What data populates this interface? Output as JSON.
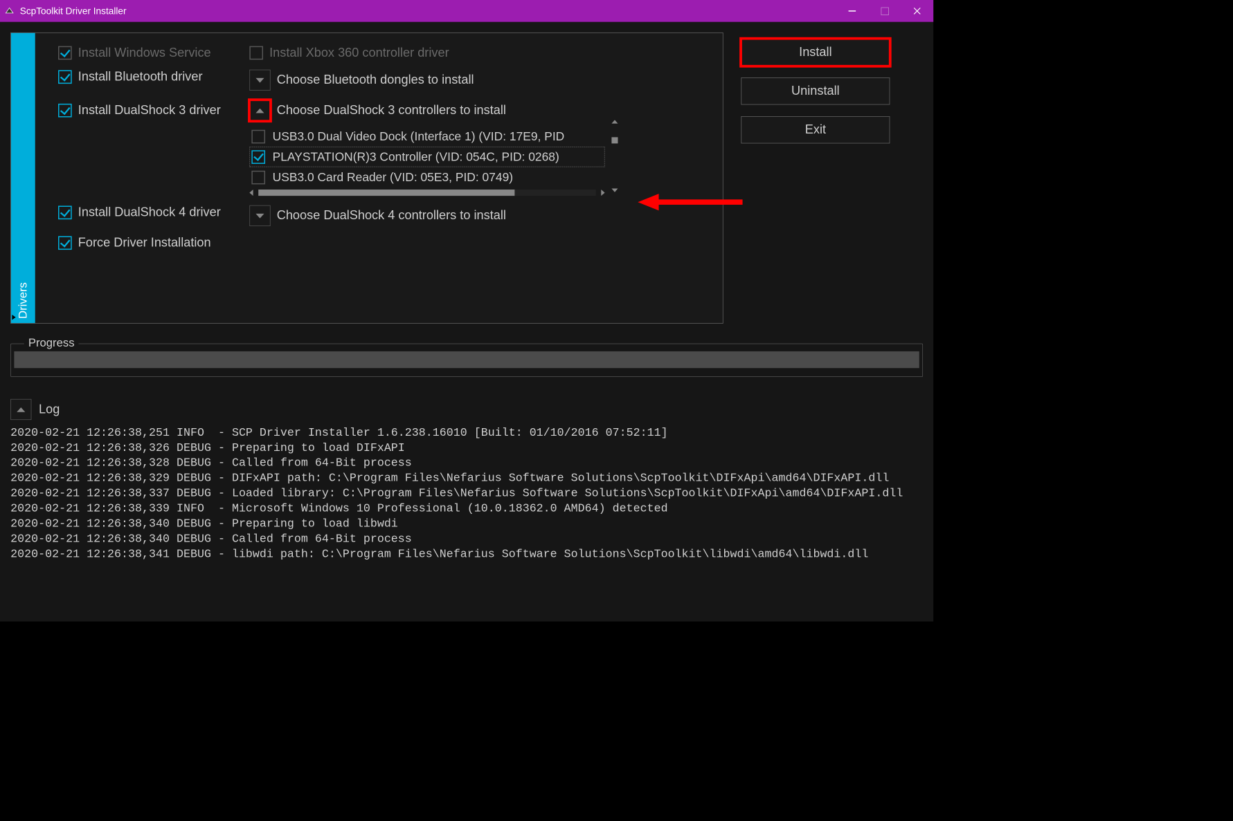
{
  "window": {
    "title": "ScpToolkit Driver Installer"
  },
  "drivers": {
    "tab_label": "Drivers",
    "install_windows_service": {
      "label": "Install Windows Service",
      "checked": true,
      "disabled": true
    },
    "install_xbox360": {
      "label": "Install Xbox 360 controller driver",
      "checked": false,
      "disabled": true
    },
    "install_bluetooth": {
      "label": "Install Bluetooth driver",
      "checked": true
    },
    "bluetooth_dropdown": {
      "label": "Choose Bluetooth dongles to install",
      "expanded": false
    },
    "install_ds3": {
      "label": "Install DualShock 3 driver",
      "checked": true
    },
    "ds3_dropdown": {
      "label": "Choose DualShock 3 controllers to install",
      "expanded": true
    },
    "ds3_devices": [
      {
        "label": "USB3.0 Dual Video Dock (Interface 1) (VID: 17E9, PID",
        "checked": false
      },
      {
        "label": "PLAYSTATION(R)3 Controller (VID: 054C, PID: 0268)",
        "checked": true,
        "selected": true
      },
      {
        "label": "USB3.0 Card Reader (VID: 05E3, PID: 0749)",
        "checked": false
      }
    ],
    "install_ds4": {
      "label": "Install DualShock 4 driver",
      "checked": true
    },
    "ds4_dropdown": {
      "label": "Choose DualShock 4 controllers to install",
      "expanded": false
    },
    "force_install": {
      "label": "Force Driver Installation",
      "checked": true
    }
  },
  "actions": {
    "install": "Install",
    "uninstall": "Uninstall",
    "exit": "Exit"
  },
  "progress": {
    "label": "Progress"
  },
  "log": {
    "label": "Log",
    "lines": [
      "2020-02-21 12:26:38,251 INFO  - SCP Driver Installer 1.6.238.16010 [Built: 01/10/2016 07:52:11]",
      "2020-02-21 12:26:38,326 DEBUG - Preparing to load DIFxAPI",
      "2020-02-21 12:26:38,328 DEBUG - Called from 64-Bit process",
      "2020-02-21 12:26:38,329 DEBUG - DIFxAPI path: C:\\Program Files\\Nefarius Software Solutions\\ScpToolkit\\DIFxApi\\amd64\\DIFxAPI.dll",
      "2020-02-21 12:26:38,337 DEBUG - Loaded library: C:\\Program Files\\Nefarius Software Solutions\\ScpToolkit\\DIFxApi\\amd64\\DIFxAPI.dll",
      "2020-02-21 12:26:38,339 INFO  - Microsoft Windows 10 Professional (10.0.18362.0 AMD64) detected",
      "2020-02-21 12:26:38,340 DEBUG - Preparing to load libwdi",
      "2020-02-21 12:26:38,340 DEBUG - Called from 64-Bit process",
      "2020-02-21 12:26:38,341 DEBUG - libwdi path: C:\\Program Files\\Nefarius Software Solutions\\ScpToolkit\\libwdi\\amd64\\libwdi.dll"
    ]
  }
}
